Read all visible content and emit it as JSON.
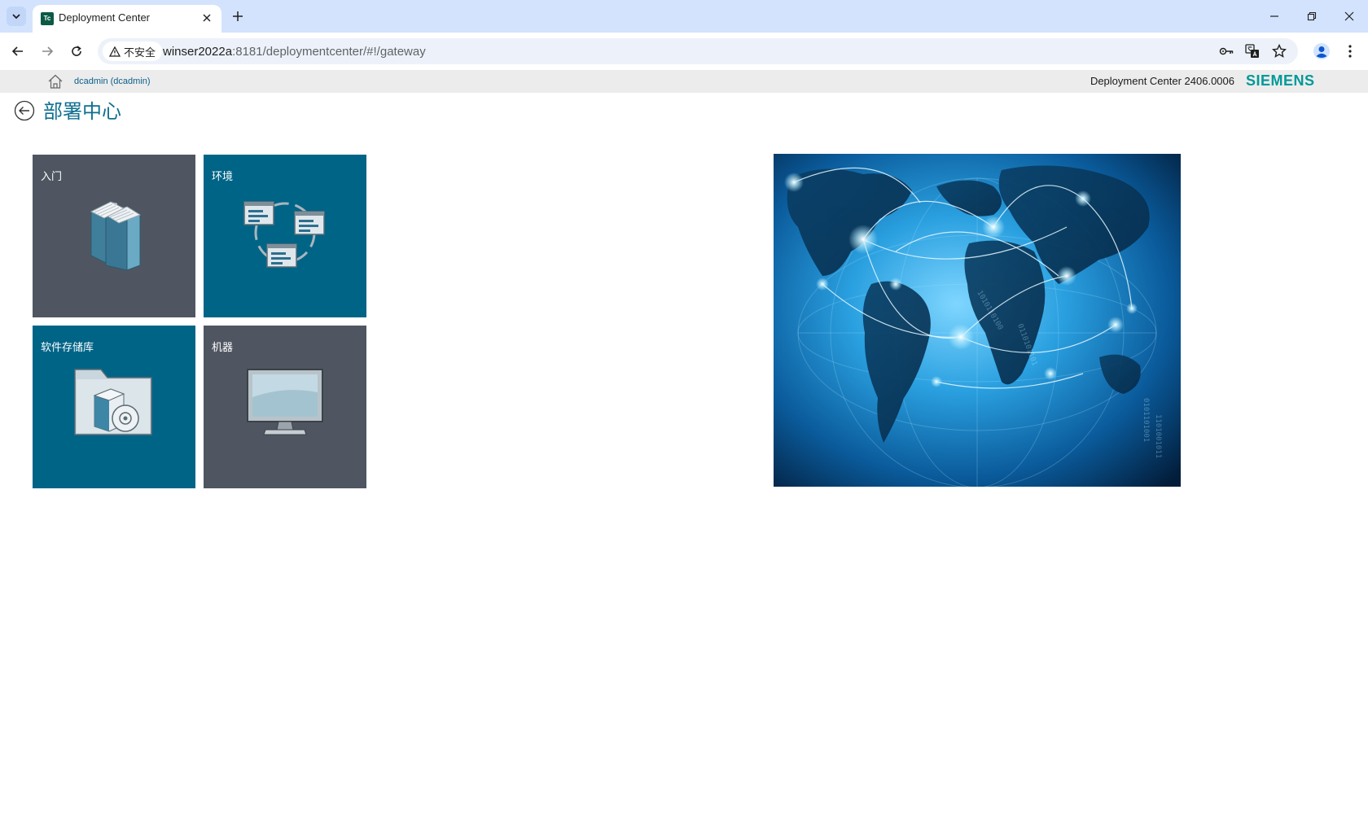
{
  "browser": {
    "tab_title": "Deployment Center",
    "favicon_text": "Tc",
    "security_label": "不安全",
    "url_host": "winser2022a",
    "url_rest": ":8181/deploymentcenter/#!/gateway"
  },
  "header": {
    "user": "dcadmin (dcadmin)",
    "product_version": "Deployment Center 2406.0006",
    "brand": "SIEMENS"
  },
  "page": {
    "title": "部署中心"
  },
  "tiles": [
    {
      "label": "入门",
      "icon": "books-icon"
    },
    {
      "label": "环境",
      "icon": "environment-windows-icon"
    },
    {
      "label": "软件存储库",
      "icon": "folder-disc-icon"
    },
    {
      "label": "机器",
      "icon": "monitor-icon"
    }
  ],
  "colors": {
    "tab_bar": "#d3e3fd",
    "tile_gray": "#4f5661",
    "tile_blue": "#006487",
    "title_blue": "#0f6f90",
    "brand_teal": "#009999"
  }
}
